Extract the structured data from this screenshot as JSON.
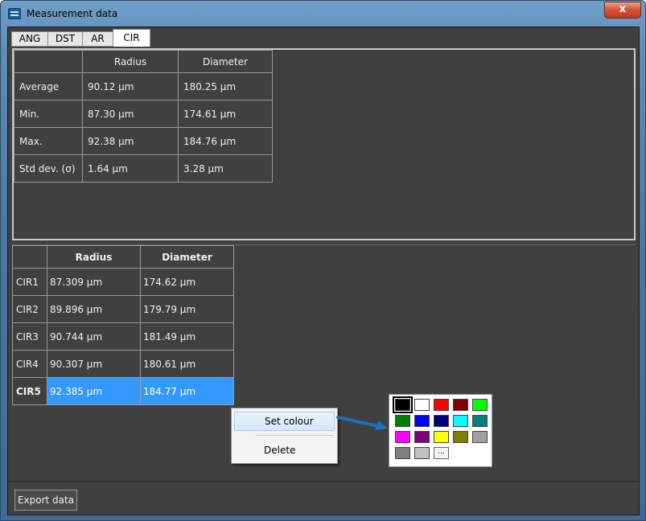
{
  "window": {
    "title": "Measurement data",
    "close_label": "x"
  },
  "tabs": [
    {
      "label": "ANG"
    },
    {
      "label": "DST"
    },
    {
      "label": "AR"
    },
    {
      "label": "CIR",
      "active": true
    }
  ],
  "summary": {
    "headers": [
      "Radius",
      "Diameter"
    ],
    "rows": [
      {
        "label": "Average",
        "radius": "90.12 µm",
        "diameter": "180.25 µm"
      },
      {
        "label": "Min.",
        "radius": "87.30 µm",
        "diameter": "174.61 µm"
      },
      {
        "label": "Max.",
        "radius": "92.38 µm",
        "diameter": "184.76 µm"
      },
      {
        "label": "Std dev. (σ)",
        "radius": "1.64 µm",
        "diameter": "3.28 µm"
      }
    ]
  },
  "details": {
    "headers": [
      "Radius",
      "Diameter"
    ],
    "rows": [
      {
        "label": "CIR1",
        "radius": "87.309 µm",
        "diameter": "174.62 µm"
      },
      {
        "label": "CIR2",
        "radius": "89.896 µm",
        "diameter": "179.79 µm"
      },
      {
        "label": "CIR3",
        "radius": "90.744 µm",
        "diameter": "181.49 µm"
      },
      {
        "label": "CIR4",
        "radius": "90.307 µm",
        "diameter": "180.61 µm"
      },
      {
        "label": "CIR5",
        "radius": "92.385 µm",
        "diameter": "184.77 µm",
        "selected": true
      }
    ]
  },
  "context_menu": {
    "items": [
      {
        "label": "Set colour"
      },
      {
        "label": "Delete"
      }
    ]
  },
  "palette": {
    "selected": "#000000",
    "colors": [
      "#000000",
      "#ffffff",
      "#ff0000",
      "#800000",
      "#00ff00",
      "#008000",
      "#0000ff",
      "#000080",
      "#00ffff",
      "#008080",
      "#ff00ff",
      "#800080",
      "#ffff00",
      "#808000",
      "#a0a0a0",
      "#808080",
      "#c0c0c0"
    ],
    "more_label": "..."
  },
  "footer": {
    "export_label": "Export data"
  },
  "colors": {
    "selection": "#3399ff",
    "panel": "#404040",
    "arrow": "#1f6fbd"
  }
}
